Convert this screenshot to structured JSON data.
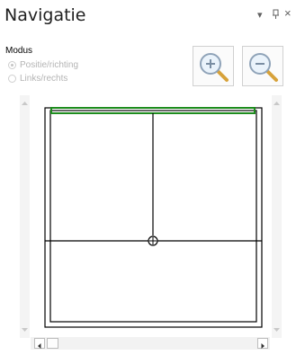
{
  "panel": {
    "title": "Navigatie",
    "dropdown_icon": "chevron-down-icon",
    "pin_icon": "pin-icon",
    "close_icon": "close-icon",
    "dropdown_glyph": "▾",
    "pin_glyph": "ᵽ",
    "close_glyph": "×"
  },
  "modus": {
    "label": "Modus",
    "options": [
      {
        "label": "Positie/richting",
        "checked": true,
        "enabled": false
      },
      {
        "label": "Links/rechts",
        "checked": false,
        "enabled": false
      }
    ]
  },
  "toolbar": {
    "zoom_in_icon": "zoom-in-icon",
    "zoom_out_icon": "zoom-out-icon"
  },
  "colors": {
    "highlight": "#1e8c1e",
    "lines": "#000000",
    "scroll_track": "#f2f2f2",
    "disabled_text": "#b4b4b4"
  }
}
